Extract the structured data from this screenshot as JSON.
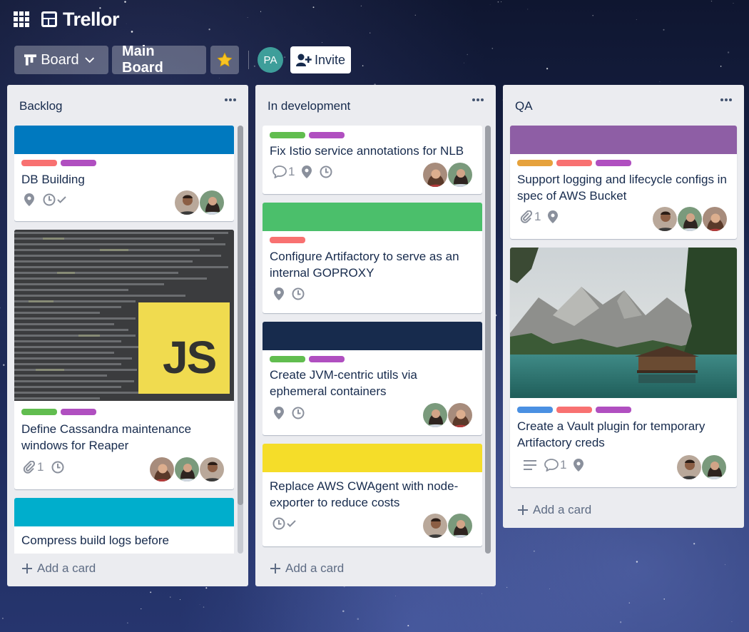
{
  "app": {
    "name": "Trellor"
  },
  "board_bar": {
    "view_label": "Board",
    "board_name": "Main Board",
    "member_initials": "PA",
    "invite_label": "Invite"
  },
  "lists": [
    {
      "title": "Backlog",
      "add_card": "Add a card",
      "cards": [
        {
          "title": "DB Building",
          "cover_color": "#0079bf",
          "labels": [
            "#f87171",
            "#b04fc0"
          ],
          "badges": [
            "location-icon",
            "due-date-check-icon"
          ]
        },
        {
          "title": "Define Cassandra maintenance windows for Reaper",
          "cover": "javascript-code-image",
          "cover_badge": "JS",
          "labels": [
            "#61bd4f",
            "#b04fc0"
          ],
          "attachments": "1",
          "badges": [
            "attachment-icon",
            "clock-icon"
          ]
        },
        {
          "title": "Compress build logs before",
          "cover_color": "#00aecc"
        }
      ]
    },
    {
      "title": "In development",
      "add_card": "Add a card",
      "cards": [
        {
          "title": "Fix Istio service annotations for NLB",
          "labels": [
            "#61bd4f",
            "#b04fc0"
          ],
          "comments": "1",
          "badges": [
            "comment-icon",
            "location-icon",
            "clock-icon"
          ]
        },
        {
          "title": "Configure Artifactory to serve as an internal GOPROXY",
          "cover_color": "#4bbf6b",
          "labels": [
            "#f87171"
          ],
          "badges": [
            "location-icon",
            "clock-icon"
          ]
        },
        {
          "title": "Create JVM-centric utils via ephemeral containers",
          "cover_color": "#172b4d",
          "labels": [
            "#61bd4f",
            "#b04fc0"
          ],
          "badges": [
            "location-icon",
            "clock-icon"
          ]
        },
        {
          "title": "Replace AWS CWAgent with node-exporter to reduce costs",
          "cover_color": "#f5dd29",
          "badges": [
            "due-date-check-icon"
          ]
        }
      ]
    },
    {
      "title": "QA",
      "add_card": "Add a card",
      "cards": [
        {
          "title": "Support logging and lifecycle configs in spec of AWS Bucket",
          "cover_color": "#8e5ea5",
          "labels": [
            "#e6a23c",
            "#f87171",
            "#b04fc0"
          ],
          "attachments": "1",
          "badges": [
            "attachment-icon",
            "location-icon"
          ]
        },
        {
          "title": "Create a Vault plugin for temporary Artifactory creds",
          "cover": "mountain-lake-photo",
          "labels": [
            "#4a90e2",
            "#f87171",
            "#b04fc0"
          ],
          "comments": "1",
          "badges": [
            "description-icon",
            "comment-icon",
            "location-icon"
          ]
        }
      ]
    }
  ]
}
